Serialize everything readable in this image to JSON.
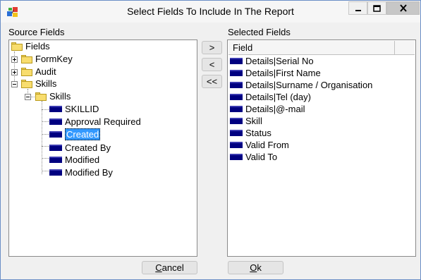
{
  "window": {
    "title": "Select Fields To Include In The Report"
  },
  "source": {
    "label": "Source Fields",
    "tree": {
      "root": "Fields",
      "folders": [
        "FormKey",
        "Audit",
        "Skills"
      ],
      "subfolder": "Skills",
      "fields": [
        "SKILLID",
        "Approval Required",
        "Created",
        "Created By",
        "Modified",
        "Modified By"
      ],
      "selected_field": "Created"
    }
  },
  "selected": {
    "label": "Selected Fields",
    "column_header": "Field",
    "items": [
      "Details|Serial No",
      "Details|First Name",
      "Details|Surname / Organisation",
      "Details|Tel (day)",
      "Details|@-mail",
      "Skill",
      "Status",
      "Valid From",
      "Valid To"
    ]
  },
  "buttons": {
    "add": ">",
    "remove": "<",
    "remove_all": "<<",
    "cancel_first": "C",
    "cancel_rest": "ancel",
    "ok_first": "O",
    "ok_rest": "k"
  },
  "colors": {
    "selection": "#3399ff",
    "field_icon": "#000080",
    "folder": "#f8dd6e"
  }
}
